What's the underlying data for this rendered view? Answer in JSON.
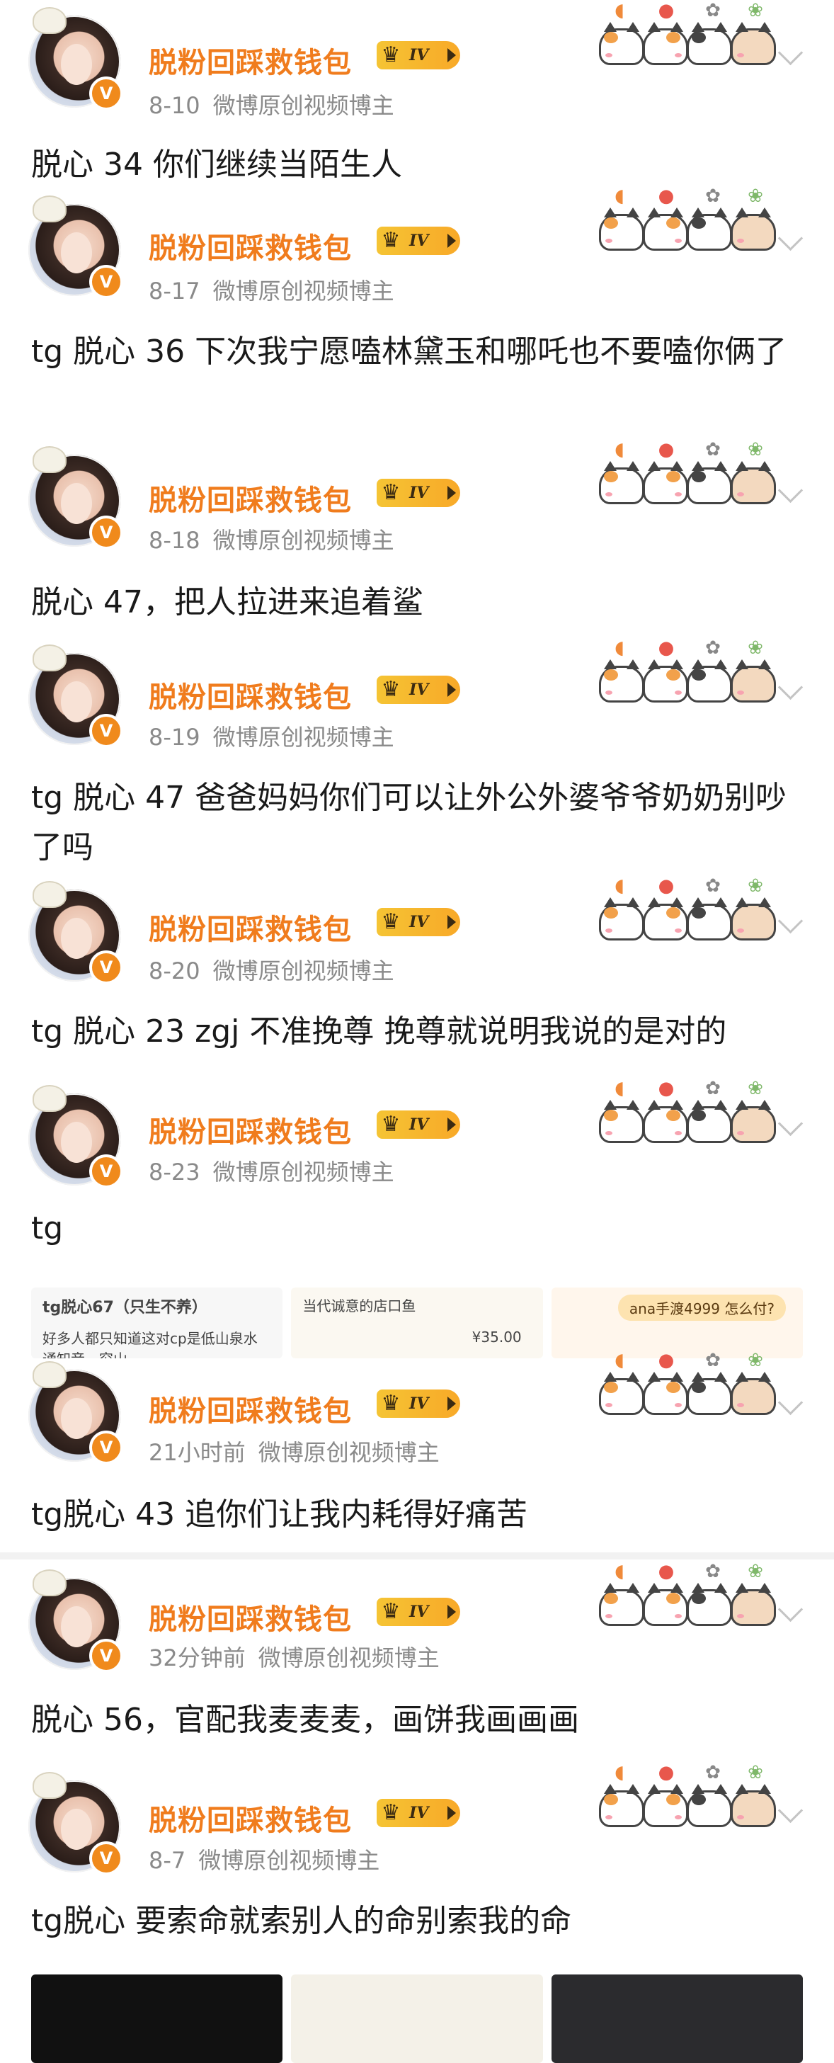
{
  "posts": [
    {
      "name": "脱粉回踩救钱包",
      "level": "IV",
      "time": "8-10",
      "source": "微博原创视频博主",
      "text": "脱心 34 你们继续当陌生人"
    },
    {
      "name": "脱粉回踩救钱包",
      "level": "IV",
      "time": "8-17",
      "source": "微博原创视频博主",
      "text": "tg 脱心 36 下次我宁愿嗑林黛玉和哪吒也不要嗑你俩了"
    },
    {
      "name": "脱粉回踩救钱包",
      "level": "IV",
      "time": "8-18",
      "source": "微博原创视频博主",
      "text": "脱心 47，把人拉进来追着鲨"
    },
    {
      "name": "脱粉回踩救钱包",
      "level": "IV",
      "time": "8-19",
      "source": "微博原创视频博主",
      "text": "tg 脱心 47  爸爸妈妈你们可以让外公外婆爷爷奶奶别吵了吗"
    },
    {
      "name": "脱粉回踩救钱包",
      "level": "IV",
      "time": "8-20",
      "source": "微博原创视频博主",
      "text": "tg 脱心 23 zgj 不准挽尊 挽尊就说明我说的是对的"
    },
    {
      "name": "脱粉回踩救钱包",
      "level": "IV",
      "time": "8-23",
      "source": "微博原创视频博主",
      "text": "tg"
    },
    {
      "name": "脱粉回踩救钱包",
      "level": "IV",
      "time": "21小时前",
      "source": "微博原创视频博主",
      "text": "tg脱心 43 追你们让我内耗得好痛苦"
    },
    {
      "name": "脱粉回踩救钱包",
      "level": "IV",
      "time": "32分钟前",
      "source": "微博原创视频博主",
      "text": "脱心 56，官配我麦麦麦，画饼我画画画"
    },
    {
      "name": "脱粉回踩救钱包",
      "level": "IV",
      "time": "8-7",
      "source": "微博原创视频博主",
      "text": "tg脱心 要索命就索别人的命别索我的命"
    }
  ],
  "preview_images": {
    "thumb1_text": "tg脱心67（只生不养）",
    "thumb1_sub": "好多人都只知道这对cp是低山泉水通知音，穷山",
    "thumb2_text": "当代诚意的店口鱼",
    "thumb2_price": "¥35.00",
    "thumb3_pill": "ana手渡4999 怎么付?"
  },
  "colors": {
    "name": "#f07c1d",
    "meta": "#8a8a8a",
    "badge": "#f5c434"
  }
}
